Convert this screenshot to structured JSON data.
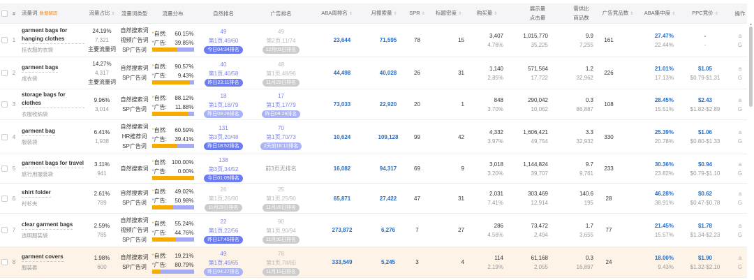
{
  "headers": {
    "keyword": "流量词",
    "keyword_tag": "数据解码",
    "share": "流量占比",
    "type": "流量词类型",
    "dist": "流量分布",
    "natural": "自然排名",
    "ad": "广告排名",
    "aba": "ABA周排名",
    "monthly": "月搜索量",
    "spr": "SPR",
    "title": "标题密度",
    "buy": "购买量",
    "show": "展示量",
    "click": "点击量",
    "ratio": "需供比",
    "products": "商品数",
    "adcomp": "广告竞品数",
    "abaconc": "ABA集中度",
    "ppc": "PPC竞价",
    "op": "操作"
  },
  "labels": {
    "natural": "自然:",
    "ad": "广告:",
    "op_a": "a",
    "op_g": "G"
  },
  "rows": [
    {
      "idx": "1",
      "kw": "garment bags for hanging clothes",
      "kwcn": "挂衣服的衣袋",
      "share": "24.19%",
      "share_n": "7,321",
      "share_tag": "主要流量词",
      "types": [
        "自然搜索词",
        "视频广告词",
        "SP广告词"
      ],
      "nat_pct": "60.15%",
      "ad_pct": "39.85%",
      "nat_frac": 0.6015,
      "nr": {
        "rank": "49",
        "page": "第1页,49/60",
        "badge": "今日04:34排名",
        "style": "active"
      },
      "ar": {
        "rank": "49",
        "page": "第2页,11/74",
        "badge": "12月01日排名",
        "style": "gray"
      },
      "aba": "23,644",
      "monthly": "71,595",
      "spr": "78",
      "title": "15",
      "buy": "3,407",
      "buy_pct": "4.76%",
      "show": "1,015,770",
      "click": "35,225",
      "ratio": "9.9",
      "products": "7,255",
      "adcomp": "161",
      "conc": "27.47%",
      "conc2": "22.44%",
      "ppc": "-",
      "ppc_range": "-"
    },
    {
      "idx": "2",
      "kw": "garment bags",
      "kwcn": "成衣袋",
      "share": "14.27%",
      "share_n": "4,317",
      "share_tag": "主要流量词",
      "types": [
        "自然搜索词",
        "SP广告词"
      ],
      "nat_pct": "90.57%",
      "ad_pct": "9.43%",
      "nat_frac": 0.9057,
      "nr": {
        "rank": "40",
        "page": "第1页,40/58",
        "badge": "昨日23:11排名",
        "style": "active"
      },
      "ar": {
        "rank": "48",
        "page": "第1页,48/96",
        "badge": "11月29日排名",
        "style": "gray"
      },
      "aba": "44,498",
      "monthly": "40,028",
      "spr": "26",
      "title": "31",
      "buy": "1,140",
      "buy_pct": "2.85%",
      "show": "571,564",
      "click": "17,722",
      "ratio": "1.2",
      "products": "32,962",
      "adcomp": "226",
      "conc": "21.01%",
      "conc2": "17.13%",
      "ppc": "$1.05",
      "ppc_range": "$0.79-$1.31"
    },
    {
      "idx": "3",
      "kw": "storage bags for clothes",
      "kwcn": "衣服收纳袋",
      "share": "9.96%",
      "share_n": "3,014",
      "share_tag": "",
      "types": [
        "自然搜索词",
        "SP广告词"
      ],
      "nat_pct": "88.12%",
      "ad_pct": "11.88%",
      "nat_frac": 0.8812,
      "nr": {
        "rank": "18",
        "page": "第1页,18/79",
        "badge": "昨日09:28排名",
        "style": "light"
      },
      "ar": {
        "rank": "17",
        "page": "第1页,17/79",
        "badge": "昨日09:28排名",
        "style": "light"
      },
      "aba": "73,033",
      "monthly": "22,920",
      "spr": "20",
      "title": "1",
      "buy": "848",
      "buy_pct": "3.70%",
      "show": "290,042",
      "click": "10,062",
      "ratio": "0.3",
      "products": "86,887",
      "adcomp": "108",
      "conc": "28.45%",
      "conc2": "15.51%",
      "ppc": "$2.43",
      "ppc_range": "$1.82-$2.89"
    },
    {
      "idx": "4",
      "kw": "garment bag",
      "kwcn": "服装袋",
      "share": "6.41%",
      "share_n": "1,938",
      "share_tag": "",
      "types": [
        "自然搜索词",
        "HR推荐词",
        "SP广告词"
      ],
      "nat_pct": "60.59%",
      "ad_pct": "39.41%",
      "nat_frac": 0.6059,
      "nr": {
        "rank": "131",
        "page": "第3页,20/48",
        "badge": "昨日18:52排名",
        "style": "active"
      },
      "ar": {
        "rank": "70",
        "page": "第1页,70/73",
        "badge": "2天前18:12排名",
        "style": "light"
      },
      "aba": "10,624",
      "monthly": "109,128",
      "spr": "99",
      "title": "42",
      "buy": "4,332",
      "buy_pct": "3.97%",
      "show": "1,606,421",
      "click": "49,754",
      "ratio": "3.3",
      "products": "32,932",
      "adcomp": "330",
      "conc": "25.39%",
      "conc2": "20.78%",
      "ppc": "$1.06",
      "ppc_range": "$0.80-$1.33"
    },
    {
      "idx": "5",
      "kw": "garment bags for travel",
      "kwcn": "旅行用服装袋",
      "share": "3.11%",
      "share_n": "941",
      "share_tag": "",
      "types": [
        "自然搜索词"
      ],
      "nat_pct": "100.00%",
      "ad_pct": "0.00%",
      "nat_frac": 1.0,
      "nr": {
        "rank": "138",
        "page": "第3页,34/52",
        "badge": "今日01:09排名",
        "style": "active"
      },
      "ar": {
        "none": "前3页无排名"
      },
      "aba": "16,082",
      "monthly": "94,317",
      "spr": "69",
      "title": "9",
      "buy": "3,018",
      "buy_pct": "3.20%",
      "show": "1,144,824",
      "click": "39,707",
      "ratio": "9.7",
      "products": "9,761",
      "adcomp": "233",
      "conc": "30.36%",
      "conc2": "23.82%",
      "ppc": "$0.94",
      "ppc_range": "$0.79-$1.10"
    },
    {
      "idx": "6",
      "kw": "shirt folder",
      "kwcn": "衬衫夹",
      "share": "2.61%",
      "share_n": "789",
      "share_tag": "",
      "types": [
        "自然搜索词",
        "SP广告词"
      ],
      "nat_pct": "49.02%",
      "ad_pct": "50.98%",
      "nat_frac": 0.4902,
      "nr": {
        "rank": "26",
        "page": "第1页,26/90",
        "badge": "11月28日排名",
        "style": "gray"
      },
      "ar": {
        "rank": "25",
        "page": "第1页,25/90",
        "badge": "11月28日排名",
        "style": "gray"
      },
      "aba": "65,871",
      "monthly": "27,422",
      "spr": "47",
      "title": "31",
      "buy": "2,031",
      "buy_pct": "7.41%",
      "show": "303,469",
      "click": "12,914",
      "ratio": "140.6",
      "products": "195",
      "adcomp": "28",
      "conc": "46.28%",
      "conc2": "38.91%",
      "ppc": "$0.62",
      "ppc_range": "$0.47-$0.78"
    },
    {
      "idx": "7",
      "kw": "clear garment bags",
      "kwcn": "透明服装袋",
      "share": "2.59%",
      "share_n": "785",
      "share_tag": "",
      "types": [
        "自然搜索词",
        "视频广告词",
        "SP广告词"
      ],
      "nat_pct": "55.24%",
      "ad_pct": "44.76%",
      "nat_frac": 0.5524,
      "nr": {
        "rank": "22",
        "page": "第1页,22/56",
        "badge": "昨日17:45排名",
        "style": "active"
      },
      "ar": {
        "rank": "90",
        "page": "第1页,90/94",
        "badge": "11月30日排名",
        "style": "gray"
      },
      "aba": "273,872",
      "monthly": "6,276",
      "spr": "7",
      "title": "27",
      "buy": "286",
      "buy_pct": "4.56%",
      "show": "73,472",
      "click": "2,494",
      "ratio": "1.7",
      "products": "3,655",
      "adcomp": "77",
      "conc": "21.45%",
      "conc2": "15.57%",
      "ppc": "$1.78",
      "ppc_range": "$1.34-$2.23"
    },
    {
      "idx": "8",
      "kw": "garment covers",
      "kwcn": "服装套",
      "share": "1.98%",
      "share_n": "600",
      "share_tag": "",
      "types": [
        "自然搜索词",
        "SP广告词"
      ],
      "nat_pct": "19.21%",
      "ad_pct": "80.79%",
      "nat_frac": 0.1921,
      "nr": {
        "rank": "49",
        "page": "第1页,49/65",
        "badge": "昨日04:27排名",
        "style": "light"
      },
      "ar": {
        "rank": "78",
        "page": "第1页,78/80",
        "badge": "11月13日排名",
        "style": "gray"
      },
      "aba": "333,549",
      "monthly": "5,245",
      "spr": "3",
      "title": "4",
      "buy": "114",
      "buy_pct": "2.19%",
      "show": "61,168",
      "click": "2,055",
      "ratio": "0.3",
      "products": "16,897",
      "adcomp": "24",
      "conc": "18.00%",
      "conc2": "9.43%",
      "ppc": "$1.90",
      "ppc_range": "$1.32-$2.10"
    }
  ]
}
